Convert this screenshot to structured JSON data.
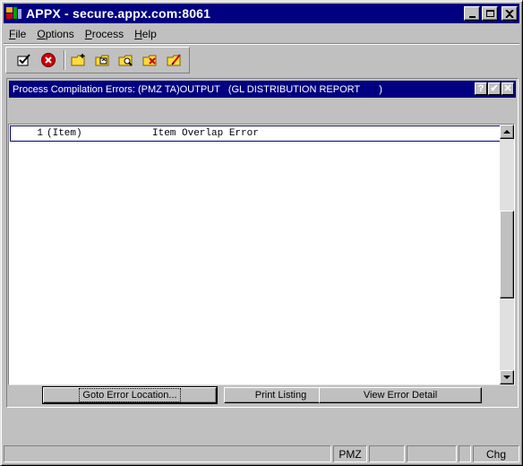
{
  "window": {
    "title": "APPX - secure.appx.com:8061"
  },
  "menu": {
    "items": [
      {
        "label": "File",
        "u": "F",
        "rest": "ile"
      },
      {
        "label": "Options",
        "u": "O",
        "rest": "ptions"
      },
      {
        "label": "Process",
        "u": "P",
        "rest": "rocess"
      },
      {
        "label": "Help",
        "u": "H",
        "rest": "elp"
      }
    ]
  },
  "toolbar": {
    "icons": [
      "checkmark-icon",
      "cancel-icon",
      "folder-new-icon",
      "folder-up-icon",
      "folder-search-icon",
      "folder-delete-icon",
      "folder-edit-icon"
    ]
  },
  "inner_window": {
    "title": "Process Compilation Errors: (PMZ TA)OUTPUT   (GL DISTRIBUTION REPORT       )",
    "help_label": "?",
    "ok_label": "✔",
    "close_label": "✕"
  },
  "errors": {
    "rows": [
      {
        "num": "1",
        "type": "(Item)",
        "message": "Item Overlap Error"
      }
    ]
  },
  "buttons": {
    "goto": {
      "label": "Goto Error Location..."
    },
    "print": {
      "label": "Print Listing"
    },
    "view": {
      "label": "View Error Detail"
    }
  },
  "status": {
    "cells": [
      "",
      "PMZ",
      "",
      "",
      "",
      "Chg"
    ]
  },
  "colors": {
    "titlebar": "#000080",
    "face": "#c0c0c0",
    "cancel_red": "#cc0000",
    "folder_yellow": "#ffdc40"
  }
}
